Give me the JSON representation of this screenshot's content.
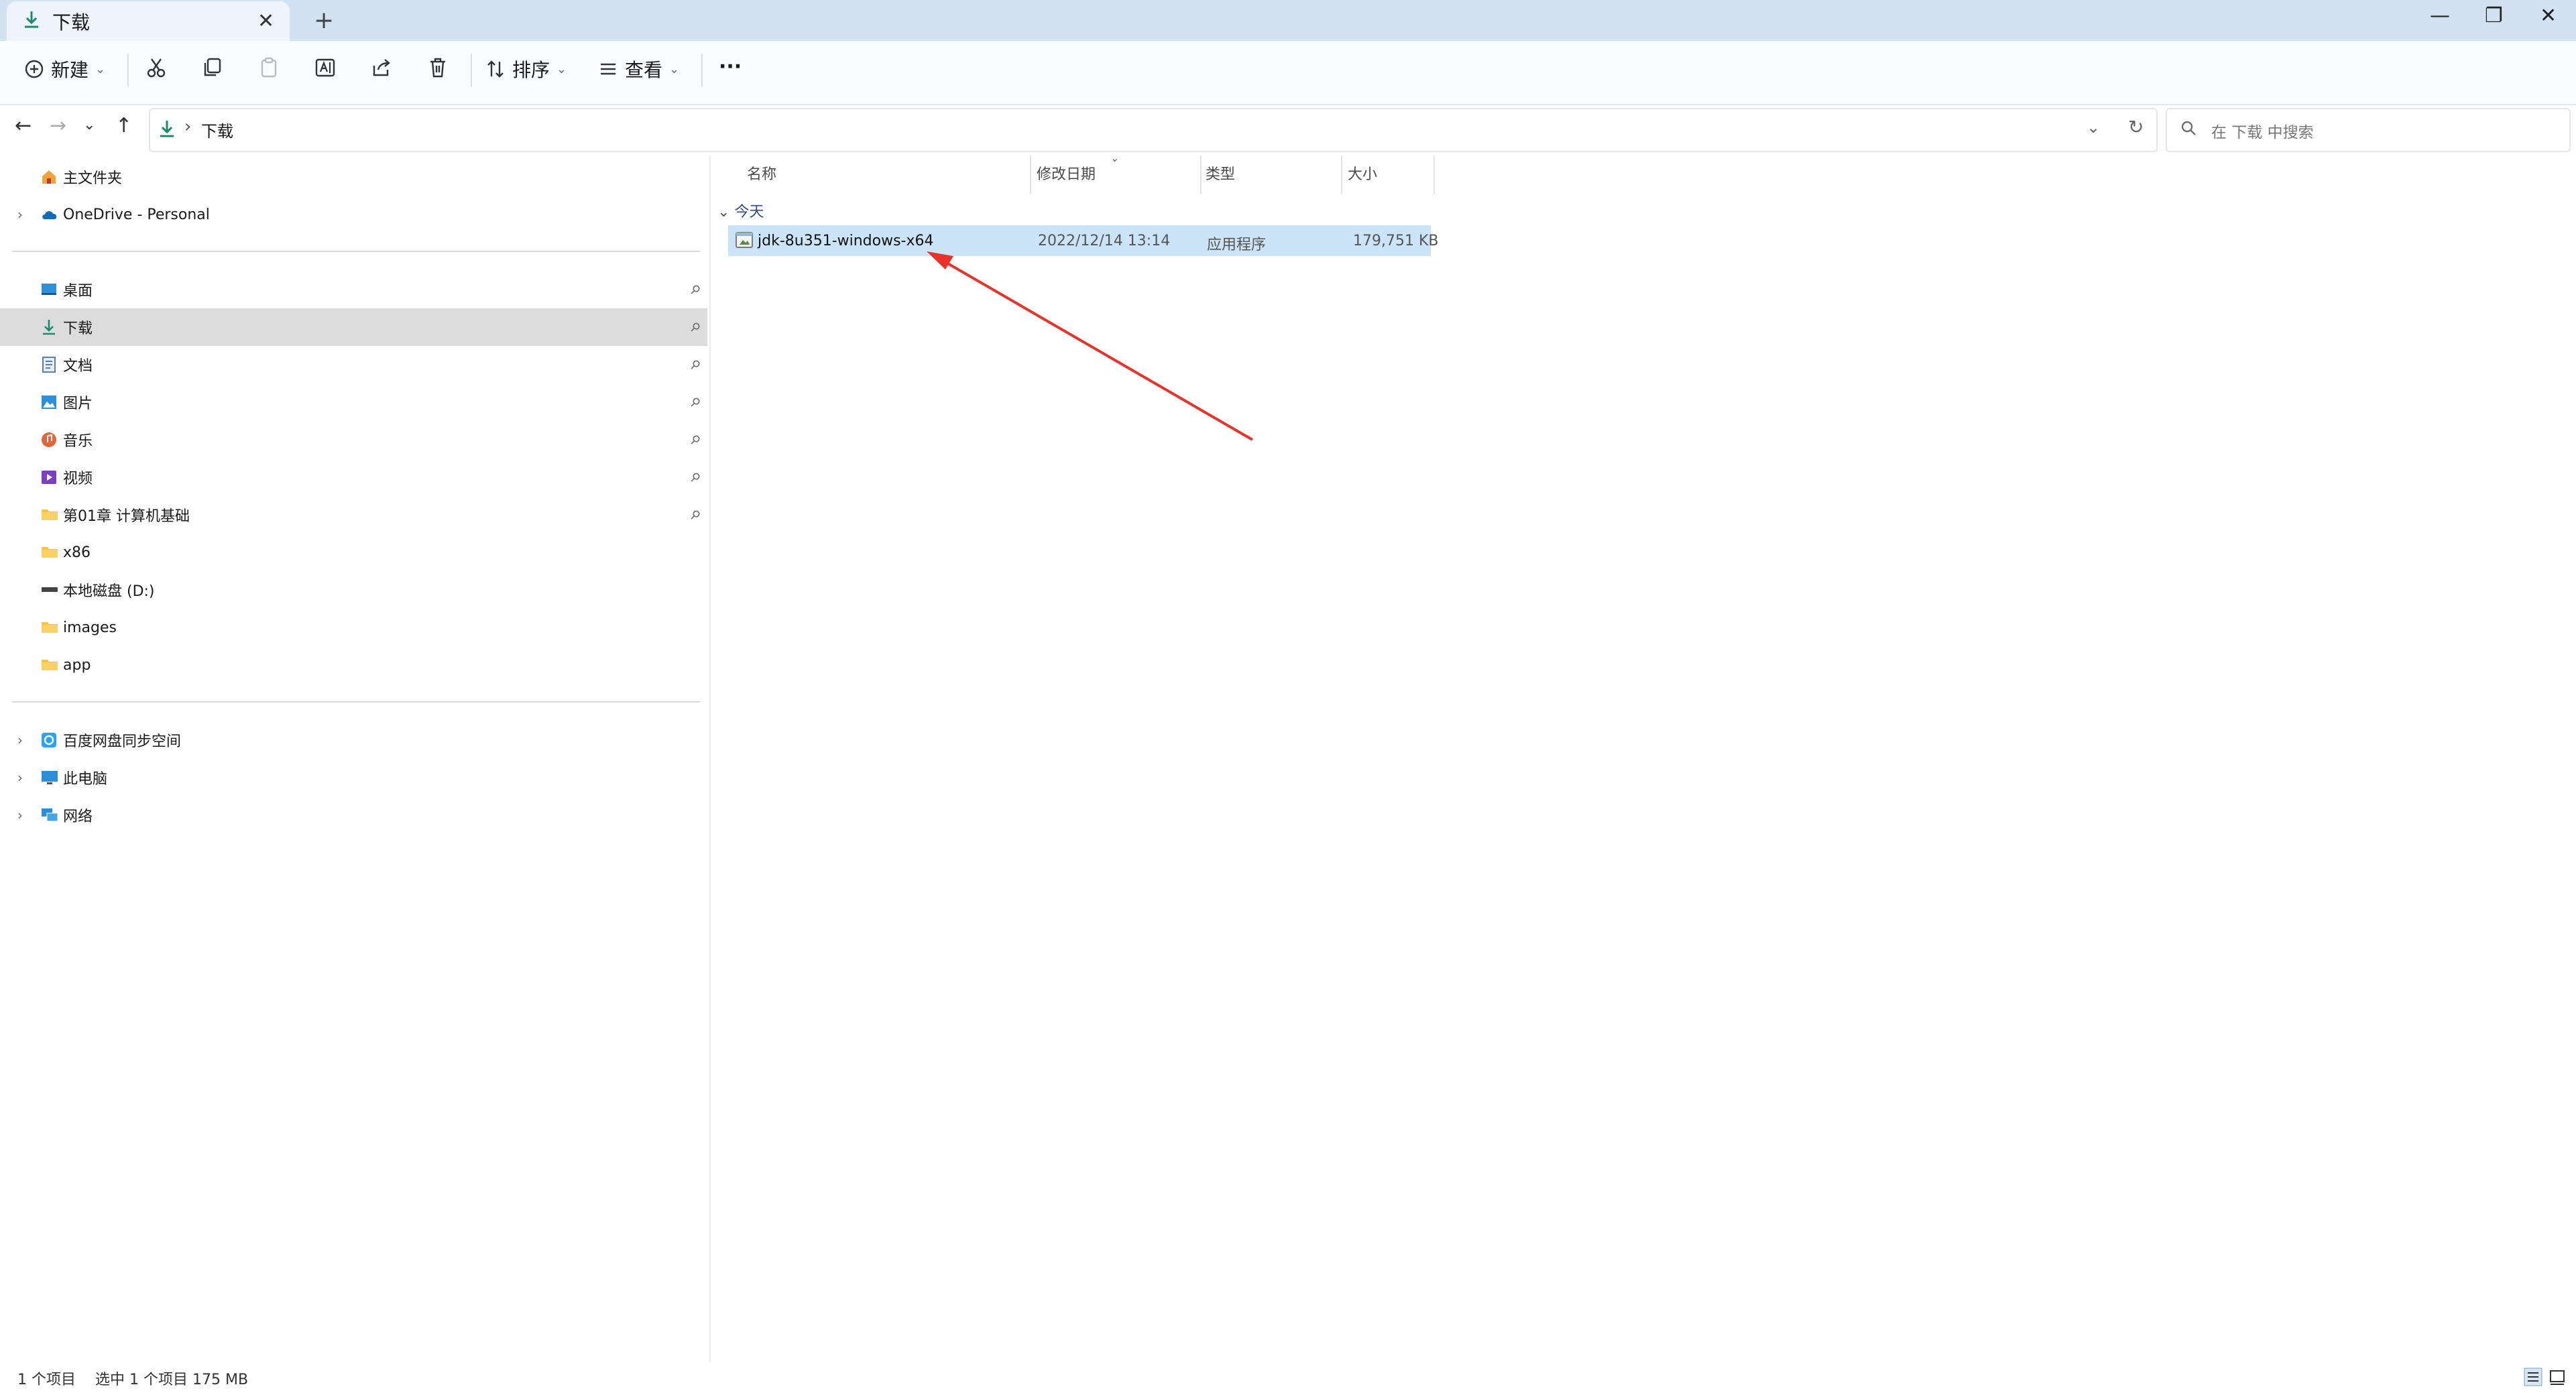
{
  "window": {
    "tab_title": "下载",
    "tab_close": "✕",
    "new_tab": "+",
    "minimize": "—",
    "restore": "❐",
    "close": "✕"
  },
  "toolbar": {
    "new_label": "新建",
    "sort_label": "排序",
    "view_label": "查看",
    "more_label": "···"
  },
  "address": {
    "path": "下载",
    "search_placeholder": "在 下载 中搜索"
  },
  "sidebar": {
    "top": [
      {
        "label": "主文件夹",
        "icon": "home-icon"
      },
      {
        "label": "OneDrive - Personal",
        "icon": "cloud-icon"
      }
    ],
    "quick": [
      {
        "label": "桌面",
        "icon": "desktop-icon",
        "pinned": true
      },
      {
        "label": "下载",
        "icon": "download-icon",
        "pinned": true
      },
      {
        "label": "文档",
        "icon": "document-icon",
        "pinned": true
      },
      {
        "label": "图片",
        "icon": "pictures-icon",
        "pinned": true
      },
      {
        "label": "音乐",
        "icon": "music-icon",
        "pinned": true
      },
      {
        "label": "视频",
        "icon": "video-icon",
        "pinned": true
      },
      {
        "label": "第01章 计算机基础",
        "icon": "folder-icon",
        "pinned": true
      },
      {
        "label": "x86",
        "icon": "folder-icon",
        "pinned": false
      },
      {
        "label": "本地磁盘 (D:)",
        "icon": "drive-icon",
        "pinned": false
      },
      {
        "label": "images",
        "icon": "folder-icon",
        "pinned": false
      },
      {
        "label": "app",
        "icon": "folder-icon",
        "pinned": false
      }
    ],
    "bottom": [
      {
        "label": "百度网盘同步空间",
        "icon": "baidu-cloud-icon"
      },
      {
        "label": "此电脑",
        "icon": "computer-icon"
      },
      {
        "label": "网络",
        "icon": "network-icon"
      }
    ]
  },
  "columns": {
    "name": "名称",
    "date": "修改日期",
    "type": "类型",
    "size": "大小"
  },
  "files": {
    "group": "今天",
    "rows": [
      {
        "name": "jdk-8u351-windows-x64",
        "date": "2022/12/14 13:14",
        "type": "应用程序",
        "size": "179,751 KB"
      }
    ]
  },
  "status": {
    "count": "1 个项目",
    "selection": "选中 1 个项目  175 MB"
  },
  "colors": {
    "accent": "#0f6cbd",
    "selection": "#cce4f7",
    "annotation_arrow": "#e8322a"
  }
}
